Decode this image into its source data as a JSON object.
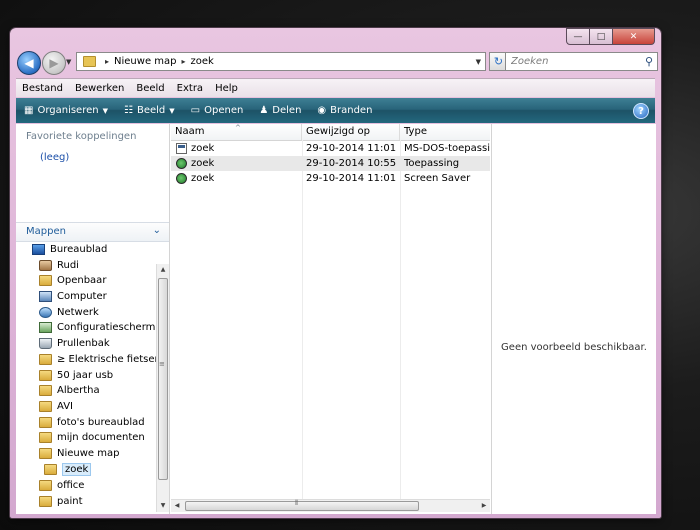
{
  "window": {
    "caption_minimize": "—",
    "caption_maximize": "□",
    "caption_close": "✕"
  },
  "address": {
    "crumbs": [
      "Nieuwe map",
      "zoek"
    ],
    "separator": "▸",
    "search_placeholder": "Zoeken"
  },
  "menu": [
    "Bestand",
    "Bewerken",
    "Beeld",
    "Extra",
    "Help"
  ],
  "toolbar": {
    "organize": "Organiseren",
    "view": "Beeld",
    "open": "Openen",
    "share": "Delen",
    "burn": "Branden"
  },
  "nav": {
    "favorites_title": "Favoriete koppelingen",
    "favorites_empty": "(leeg)",
    "folders_title": "Mappen",
    "tree": [
      {
        "label": "Bureaublad",
        "icon": "desktop-icon",
        "level": 0
      },
      {
        "label": "Rudi",
        "icon": "user-folder-icon",
        "level": 1
      },
      {
        "label": "Openbaar",
        "icon": "folder-icon",
        "level": 1
      },
      {
        "label": "Computer",
        "icon": "computer-icon",
        "level": 1
      },
      {
        "label": "Netwerk",
        "icon": "network-icon",
        "level": 1
      },
      {
        "label": "Configuratiescherm",
        "icon": "control-panel-icon",
        "level": 1
      },
      {
        "label": "Prullenbak",
        "icon": "recycle-bin-icon",
        "level": 1
      },
      {
        "label": "≥ Elektrische fietsen da",
        "icon": "folder-icon",
        "level": 1
      },
      {
        "label": "50 jaar usb",
        "icon": "folder-icon",
        "level": 1
      },
      {
        "label": "Albertha",
        "icon": "folder-icon",
        "level": 1
      },
      {
        "label": "AVI",
        "icon": "folder-icon",
        "level": 1
      },
      {
        "label": "foto's bureaublad",
        "icon": "folder-icon",
        "level": 1
      },
      {
        "label": "mijn documenten",
        "icon": "folder-icon",
        "level": 1
      },
      {
        "label": "Nieuwe map",
        "icon": "folder-icon",
        "level": 1
      },
      {
        "label": "zoek",
        "icon": "folder-icon",
        "level": 2,
        "selected": true
      },
      {
        "label": "office",
        "icon": "folder-icon",
        "level": 1
      },
      {
        "label": "paint",
        "icon": "folder-icon",
        "level": 1
      }
    ]
  },
  "files": {
    "columns": [
      "Naam",
      "Gewijzigd op",
      "Type"
    ],
    "rows": [
      {
        "name": "zoek",
        "modified": "29-10-2014 11:01",
        "type": "MS-DOS-toepassing",
        "icon": "dos-app-icon"
      },
      {
        "name": "zoek",
        "modified": "29-10-2014 10:55",
        "type": "Toepassing",
        "icon": "application-icon",
        "selected": true
      },
      {
        "name": "zoek",
        "modified": "29-10-2014 11:01",
        "type": "Screen Saver",
        "icon": "screensaver-icon"
      }
    ]
  },
  "preview": {
    "message": "Geen voorbeeld beschikbaar."
  }
}
